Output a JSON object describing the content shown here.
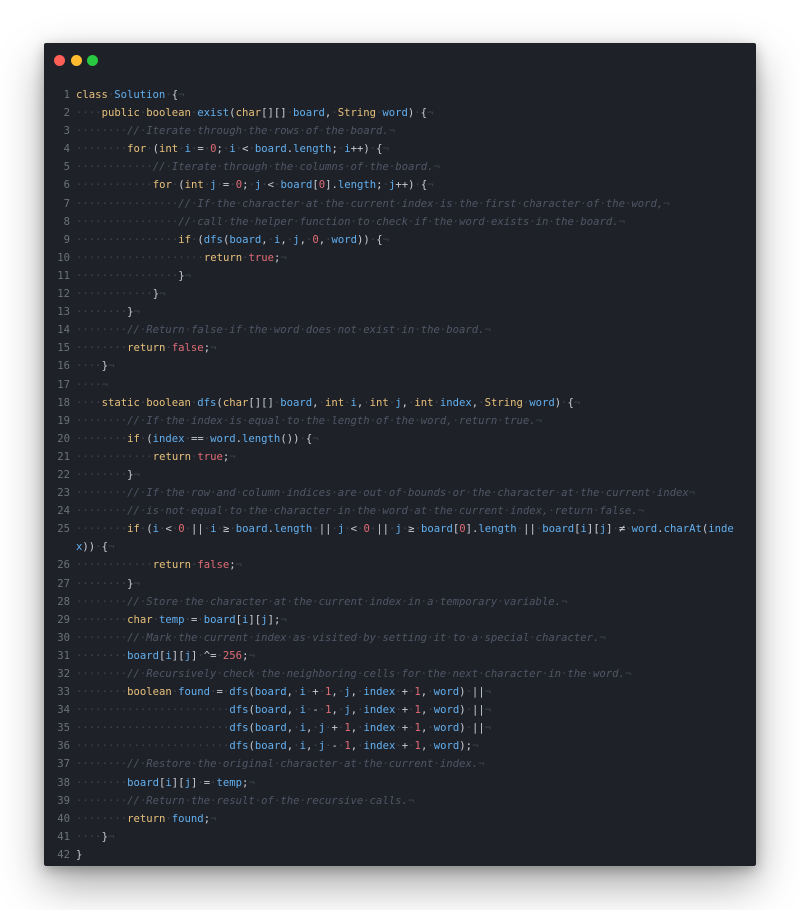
{
  "window": {
    "controls": {
      "close": "#ff5f57",
      "minimize": "#febc2e",
      "maximize": "#28c840"
    }
  },
  "editor": {
    "colors": {
      "background": "#1f2128",
      "keyword": "#e6c07b",
      "number": "#e06c75",
      "comment": "#4f5665",
      "variable": "#61afef",
      "line_number": "#6b717c",
      "whitespace_marker": "#3e4450"
    },
    "lines": [
      {
        "n": "1",
        "text": "class·Solution·{¬"
      },
      {
        "n": "2",
        "text": "····public·boolean·exist(char[][]·board,·String·word)·{¬"
      },
      {
        "n": "3",
        "text": "········//·Iterate·through·the·rows·of·the·board.¬"
      },
      {
        "n": "4",
        "text": "········for·(int·i·=·0;·i·<·board.length;·i++)·{¬"
      },
      {
        "n": "5",
        "text": "············//·Iterate·through·the·columns·of·the·board.¬"
      },
      {
        "n": "6",
        "text": "············for·(int·j·=·0;·j·<·board[0].length;·j++)·{¬"
      },
      {
        "n": "7",
        "text": "················//·If·the·character·at·the·current·index·is·the·first·character·of·the·word,¬"
      },
      {
        "n": "8",
        "text": "················//·call·the·helper·function·to·check·if·the·word·exists·in·the·board.¬"
      },
      {
        "n": "9",
        "text": "················if·(dfs(board,·i,·j,·0,·word))·{¬"
      },
      {
        "n": "10",
        "text": "····················return·true;¬"
      },
      {
        "n": "11",
        "text": "················}¬"
      },
      {
        "n": "12",
        "text": "············}¬"
      },
      {
        "n": "13",
        "text": "········}¬"
      },
      {
        "n": "14",
        "text": "········//·Return·false·if·the·word·does·not·exist·in·the·board.¬"
      },
      {
        "n": "15",
        "text": "········return·false;¬"
      },
      {
        "n": "16",
        "text": "····}¬"
      },
      {
        "n": "17",
        "text": "····¬"
      },
      {
        "n": "18",
        "text": "····static·boolean·dfs(char[][]·board,·int·i,·int·j,·int·index,·String·word)·{¬"
      },
      {
        "n": "19",
        "text": "········//·If·the·index·is·equal·to·the·length·of·the·word,·return·true.¬"
      },
      {
        "n": "20",
        "text": "········if·(index·==·word.length())·{¬"
      },
      {
        "n": "21",
        "text": "············return·true;¬"
      },
      {
        "n": "22",
        "text": "········}¬"
      },
      {
        "n": "23",
        "text": "········//·If·the·row·and·column·indices·are·out·of·bounds·or·the·character·at·the·current·index¬"
      },
      {
        "n": "24",
        "text": "········//·is·not·equal·to·the·character·in·the·word·at·the·current·index,·return·false.¬"
      },
      {
        "n": "25",
        "text": "········if·(i·<·0·||·i·≥·board.length·||·j·<·0·||·j·≥·board[0].length·||·board[i][j]·≠·word.charAt(index))·{¬",
        "wrap": true
      },
      {
        "n": "26",
        "text": "············return·false;¬"
      },
      {
        "n": "27",
        "text": "········}¬"
      },
      {
        "n": "28",
        "text": "········//·Store·the·character·at·the·current·index·in·a·temporary·variable.¬"
      },
      {
        "n": "29",
        "text": "········char·temp·=·board[i][j];¬"
      },
      {
        "n": "30",
        "text": "········//·Mark·the·current·index·as·visited·by·setting·it·to·a·special·character.¬"
      },
      {
        "n": "31",
        "text": "········board[i][j]·^=·256;¬"
      },
      {
        "n": "32",
        "text": "········//·Recursively·check·the·neighboring·cells·for·the·next·character·in·the·word.¬"
      },
      {
        "n": "33",
        "text": "········boolean·found·=·dfs(board,·i·+·1,·j,·index·+·1,·word)·||¬"
      },
      {
        "n": "34",
        "text": "························dfs(board,·i·-·1,·j,·index·+·1,·word)·||¬"
      },
      {
        "n": "35",
        "text": "························dfs(board,·i,·j·+·1,·index·+·1,·word)·||¬"
      },
      {
        "n": "36",
        "text": "························dfs(board,·i,·j·-·1,·index·+·1,·word);¬"
      },
      {
        "n": "37",
        "text": "········//·Restore·the·original·character·at·the·current·index.¬"
      },
      {
        "n": "38",
        "text": "········board[i][j]·=·temp;¬"
      },
      {
        "n": "39",
        "text": "········//·Return·the·result·of·the·recursive·calls.¬"
      },
      {
        "n": "40",
        "text": "········return·found;¬"
      },
      {
        "n": "41",
        "text": "····}¬"
      },
      {
        "n": "42",
        "text": "}"
      }
    ]
  }
}
